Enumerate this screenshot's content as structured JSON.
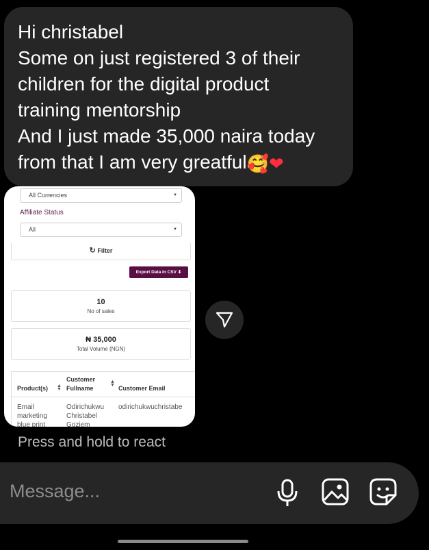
{
  "message": {
    "lines": [
      "Hi christabel",
      "Some on just registered  3 of their",
      "children for the digital product",
      "training mentorship",
      "And I just made 35,000 naira today",
      "from that I am very greatful"
    ],
    "emoji_1": "🥰",
    "emoji_2": "❤"
  },
  "screenshot": {
    "currency_select": "All Currencies",
    "affiliate_label": "Affiliate Status",
    "affiliate_select": "All",
    "filter_button": "Filter",
    "export_button": "Export Data in CSV",
    "sales_count": "10",
    "sales_label": "No of sales",
    "volume_value": "₦ 35,000",
    "volume_label": "Total Volume (NGN)",
    "table": {
      "headers": [
        "Product(s)",
        "Customer\nFullname",
        "Customer Email"
      ],
      "row": {
        "product": "Email\nmarketing\nblue print",
        "fullname": "Odirichukwu\nChristabel\nGoziem",
        "email": "odirichukwuchristabe"
      }
    }
  },
  "react_hint": "Press and hold to react",
  "composer": {
    "placeholder": "Message..."
  },
  "icons": [
    "send-icon",
    "microphone-icon",
    "gallery-icon",
    "sticker-icon"
  ]
}
